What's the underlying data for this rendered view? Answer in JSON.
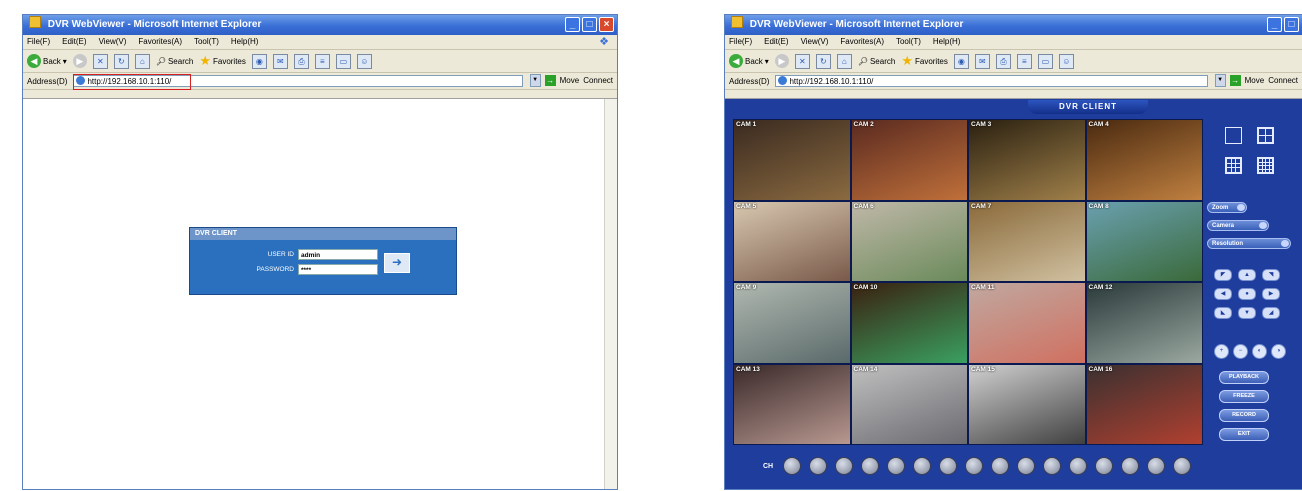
{
  "login_window": {
    "title": "DVR WebViewer - Microsoft Internet Explorer",
    "menu": [
      "File(F)",
      "Edit(E)",
      "View(V)",
      "Favorites(A)",
      "Tool(T)",
      "Help(H)"
    ],
    "toolbar": {
      "back": "Back",
      "search": "Search",
      "favorites": "Favorites"
    },
    "address_label": "Address(D)",
    "address_value": "http://192.168.10.1:110/",
    "links": [
      "Move",
      "Connect"
    ],
    "login": {
      "header": "DVR CLIENT",
      "user_label": "USER ID",
      "user_value": "admin",
      "password_label": "PASSWORD",
      "password_value": "****"
    }
  },
  "viewer_window": {
    "title": "DVR WebViewer - Microsoft Internet Explorer",
    "menu": [
      "File(F)",
      "Edit(E)",
      "View(V)",
      "Favorites(A)",
      "Tool(T)",
      "Help(H)"
    ],
    "toolbar": {
      "back": "Back",
      "search": "Search",
      "favorites": "Favorites"
    },
    "address_label": "Address(D)",
    "address_value": "http://192.168.10.1:110/",
    "links": [
      "Move",
      "Connect"
    ],
    "header": "DVR CLIENT",
    "cameras": [
      {
        "label": "CAM 1",
        "colors": [
          "#3a2a20",
          "#8a6a40"
        ]
      },
      {
        "label": "CAM 2",
        "colors": [
          "#5a2a20",
          "#c0703a"
        ]
      },
      {
        "label": "CAM 3",
        "colors": [
          "#2a2010",
          "#a0804a"
        ]
      },
      {
        "label": "CAM 4",
        "colors": [
          "#4a2a10",
          "#c08040"
        ]
      },
      {
        "label": "CAM 5",
        "colors": [
          "#d8c8b0",
          "#7a5a4a"
        ]
      },
      {
        "label": "CAM 6",
        "colors": [
          "#c0b8a8",
          "#6a8a5a"
        ]
      },
      {
        "label": "CAM 7",
        "colors": [
          "#8a6a3a",
          "#d0c0a0"
        ]
      },
      {
        "label": "CAM 8",
        "colors": [
          "#6aa0b0",
          "#3a6a3a"
        ]
      },
      {
        "label": "CAM 9",
        "colors": [
          "#b0b8b0",
          "#5a6a6a"
        ]
      },
      {
        "label": "CAM 10",
        "colors": [
          "#3a2010",
          "#3aa060"
        ]
      },
      {
        "label": "CAM 11",
        "colors": [
          "#c0a8a0",
          "#d07060"
        ]
      },
      {
        "label": "CAM 12",
        "colors": [
          "#2a3a3a",
          "#9aa8a0"
        ]
      },
      {
        "label": "CAM 13",
        "colors": [
          "#3a2a2a",
          "#b89890"
        ]
      },
      {
        "label": "CAM 14",
        "colors": [
          "#c0c0c0",
          "#6a6a70"
        ]
      },
      {
        "label": "CAM 15",
        "colors": [
          "#d0d0d0",
          "#404040"
        ]
      },
      {
        "label": "CAM 16",
        "colors": [
          "#3a3030",
          "#b04030"
        ]
      }
    ],
    "controls": {
      "zoom": "Zoom",
      "camera": "Camera",
      "resolution": "Resolution",
      "actions": [
        "PLAYBACK",
        "FREEZE",
        "RECORD",
        "EXIT"
      ],
      "cam_row_label": "CH"
    }
  }
}
